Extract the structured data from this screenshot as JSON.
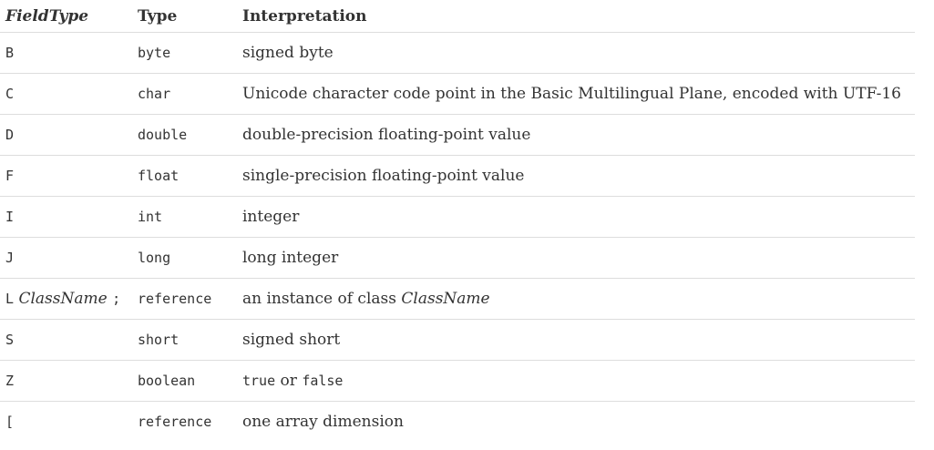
{
  "header": {
    "field_type": "FieldType",
    "type": "Type",
    "interpretation": "Interpretation"
  },
  "rows": [
    {
      "field_type": "B",
      "type": "byte",
      "interpretation": "signed byte"
    },
    {
      "field_type": "C",
      "type": "char",
      "interpretation": "Unicode character code point in the Basic Multilingual Plane, encoded with UTF-16"
    },
    {
      "field_type": "D",
      "type": "double",
      "interpretation": "double-precision floating-point value"
    },
    {
      "field_type": "F",
      "type": "float",
      "interpretation": "single-precision floating-point value"
    },
    {
      "field_type": "I",
      "type": "int",
      "interpretation": "integer"
    },
    {
      "field_type": "J",
      "type": "long",
      "interpretation": "long integer"
    },
    {
      "field_type_prefix": "L",
      "field_type_class": "ClassName",
      "field_type_suffix": ";",
      "type": "reference",
      "interpretation_prefix": "an instance of class",
      "interpretation_class": "ClassName"
    },
    {
      "field_type": "S",
      "type": "short",
      "interpretation": "signed short"
    },
    {
      "field_type": "Z",
      "type": "boolean",
      "interpretation_true": "true",
      "interpretation_or": "or",
      "interpretation_false": "false"
    },
    {
      "field_type": "[",
      "type": "reference",
      "interpretation": "one array dimension"
    }
  ]
}
